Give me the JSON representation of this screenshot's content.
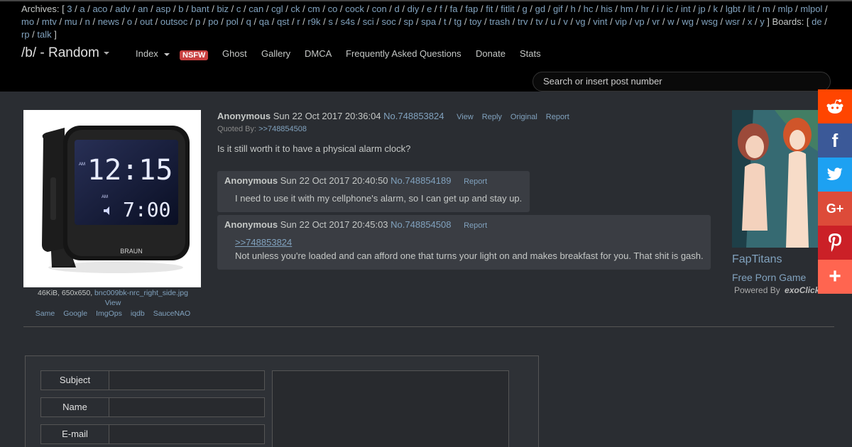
{
  "archives": {
    "prefix": "Archives: [",
    "items": [
      "3",
      "a",
      "aco",
      "adv",
      "an",
      "asp",
      "b",
      "bant",
      "biz",
      "c",
      "can",
      "cgl",
      "ck",
      "cm",
      "co",
      "cock",
      "con",
      "d",
      "diy",
      "e",
      "f",
      "fa",
      "fap",
      "fit",
      "fitlit",
      "g",
      "gd",
      "gif",
      "h",
      "hc",
      "his",
      "hm",
      "hr",
      "i",
      "ic",
      "int",
      "jp",
      "k",
      "lgbt",
      "lit",
      "m",
      "mlp",
      "mlpol",
      "mo",
      "mtv",
      "mu",
      "n",
      "news",
      "o",
      "out",
      "outsoc",
      "p",
      "po",
      "pol",
      "q",
      "qa",
      "qst",
      "r",
      "r9k",
      "s",
      "s4s",
      "sci",
      "soc",
      "sp",
      "spa",
      "t",
      "tg",
      "toy",
      "trash",
      "trv",
      "tv",
      "u",
      "v",
      "vg",
      "vint",
      "vip",
      "vp",
      "vr",
      "w",
      "wg",
      "wsg",
      "wsr",
      "x",
      "y"
    ],
    "mid": "] Boards: [",
    "boards": [
      "de",
      "rp",
      "talk"
    ],
    "suffix": "]"
  },
  "header": {
    "board_title": "/b/ - Random",
    "nav": {
      "index": "Index",
      "nsfw": "NSFW",
      "ghost": "Ghost",
      "gallery": "Gallery",
      "dmca": "DMCA",
      "faq": "Frequently Asked Questions",
      "donate": "Donate",
      "stats": "Stats"
    },
    "search_placeholder": "Search or insert post number"
  },
  "op": {
    "name": "Anonymous",
    "date": "Sun 22 Oct 2017 20:36:04",
    "number": "No.748853824",
    "links": [
      "View",
      "Reply",
      "Original",
      "Report"
    ],
    "quoted_by_label": "Quoted By:",
    "quoted_by": ">>748854508",
    "text": "Is it still worth it to have a physical alarm clock?",
    "file": {
      "info": "46KiB, 650x650,",
      "filename": "bnc009bk-nrc_right_side.jpg",
      "view": "View",
      "search_links": [
        "Same",
        "Google",
        "ImgOps",
        "iqdb",
        "SauceNAO"
      ],
      "clock_time": "12:15",
      "alarm_time": "7:00",
      "am_label": "AM",
      "brand": "BRAUN"
    }
  },
  "replies": [
    {
      "name": "Anonymous",
      "date": "Sun 22 Oct 2017 20:40:50",
      "number": "No.748854189",
      "report": "Report",
      "quote": "",
      "text": "I need to use it with my cellphone's alarm, so I can get up and stay up."
    },
    {
      "name": "Anonymous",
      "date": "Sun 22 Oct 2017 20:45:03",
      "number": "No.748854508",
      "report": "Report",
      "quote": ">>748853824",
      "text": "Not unless you're loaded and can afford one that turns your light on and makes breakfast for you. That shit is gash."
    }
  ],
  "ad": {
    "title": "FapTitans",
    "subtitle": "Free Porn Game",
    "powered_by": "Powered By",
    "powered_brand": "exoClick"
  },
  "share": [
    {
      "name": "reddit-icon",
      "color": "#ff4500"
    },
    {
      "name": "facebook-icon",
      "color": "#3b5998",
      "glyph": "f"
    },
    {
      "name": "twitter-icon",
      "color": "#1da1f2"
    },
    {
      "name": "google-plus-icon",
      "color": "#dd4b39",
      "glyph": "G+"
    },
    {
      "name": "pinterest-icon",
      "color": "#cb2027"
    },
    {
      "name": "more-share-icon",
      "color": "#ff6550",
      "glyph": "+"
    }
  ],
  "form": {
    "subject_label": "Subject",
    "name_label": "Name",
    "email_label": "E-mail"
  }
}
